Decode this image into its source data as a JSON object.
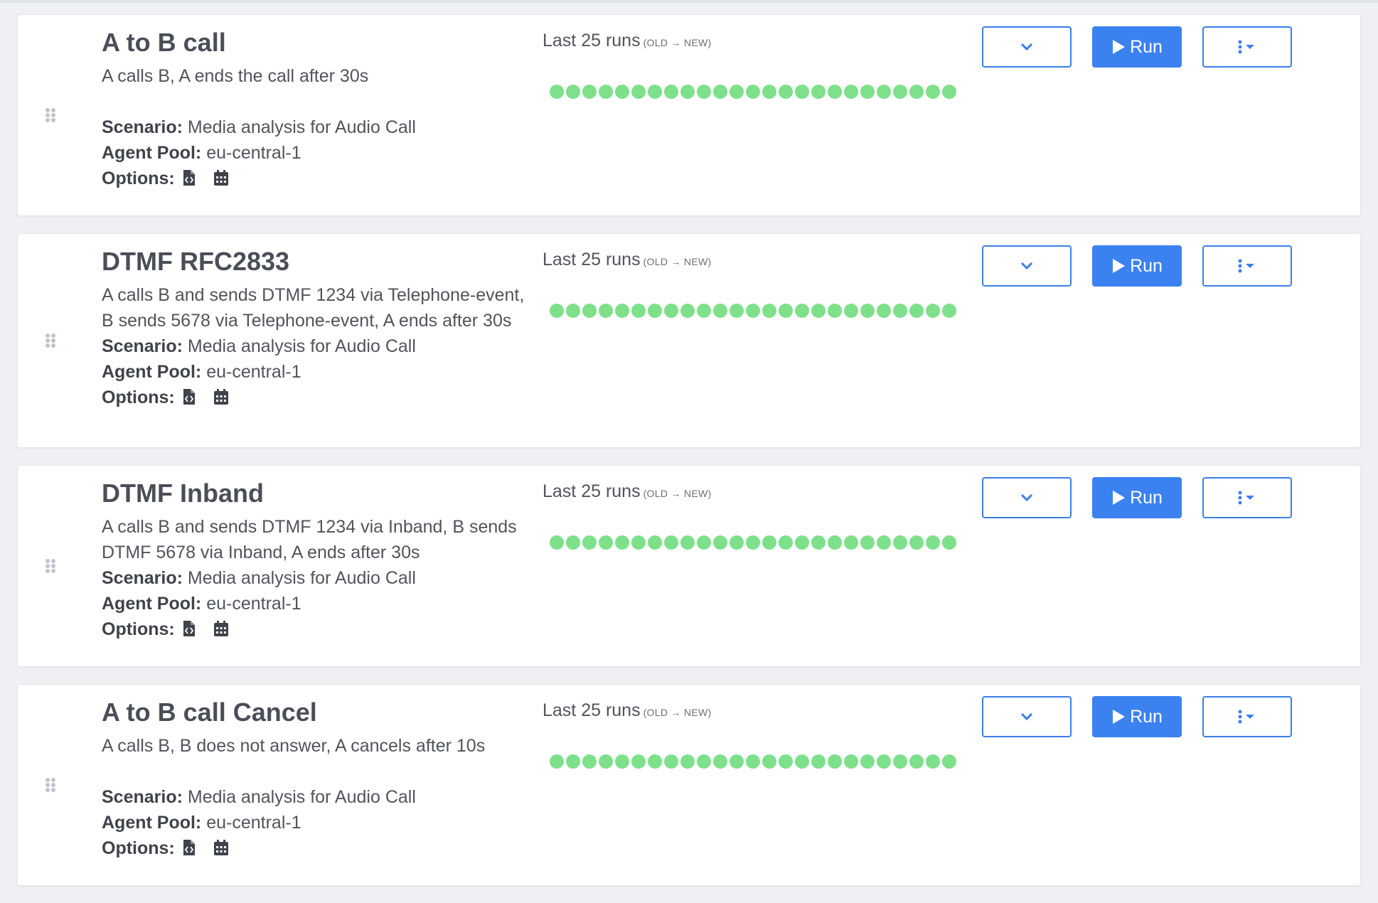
{
  "tests": [
    {
      "title": "A to B call",
      "description": "A calls B, A ends the call after 30s",
      "scenario_label": "Scenario:",
      "scenario": "Media analysis for Audio Call",
      "agent_pool_label": "Agent Pool:",
      "agent_pool": "eu-central-1",
      "options_label": "Options:",
      "runs_label": "Last 25 runs",
      "runs_sub": "(OLD → NEW)",
      "run_label": "Run",
      "runs_status": [
        "pass",
        "pass",
        "pass",
        "pass",
        "pass",
        "pass",
        "pass",
        "pass",
        "pass",
        "pass",
        "pass",
        "pass",
        "pass",
        "pass",
        "pass",
        "pass",
        "pass",
        "pass",
        "pass",
        "pass",
        "pass",
        "pass",
        "pass",
        "pass",
        "pass"
      ]
    },
    {
      "title": "DTMF RFC2833",
      "description": "A calls B and sends DTMF 1234 via Telephone-event, B sends 5678 via Telephone-event, A ends after 30s",
      "scenario_label": "Scenario:",
      "scenario": "Media analysis for Audio Call",
      "agent_pool_label": "Agent Pool:",
      "agent_pool": "eu-central-1",
      "options_label": "Options:",
      "runs_label": "Last 25 runs",
      "runs_sub": "(OLD → NEW)",
      "run_label": "Run",
      "runs_status": [
        "pass",
        "pass",
        "pass",
        "pass",
        "pass",
        "pass",
        "pass",
        "pass",
        "pass",
        "pass",
        "pass",
        "pass",
        "pass",
        "pass",
        "pass",
        "pass",
        "pass",
        "pass",
        "pass",
        "pass",
        "pass",
        "pass",
        "pass",
        "pass",
        "pass"
      ]
    },
    {
      "title": "DTMF Inband",
      "description": "A calls B and sends DTMF 1234 via Inband, B sends DTMF 5678 via Inband, A ends after 30s",
      "scenario_label": "Scenario:",
      "scenario": "Media analysis for Audio Call",
      "agent_pool_label": "Agent Pool:",
      "agent_pool": "eu-central-1",
      "options_label": "Options:",
      "runs_label": "Last 25 runs",
      "runs_sub": "(OLD → NEW)",
      "run_label": "Run",
      "runs_status": [
        "pass",
        "pass",
        "pass",
        "pass",
        "pass",
        "pass",
        "pass",
        "pass",
        "pass",
        "pass",
        "pass",
        "pass",
        "pass",
        "pass",
        "pass",
        "pass",
        "pass",
        "pass",
        "pass",
        "pass",
        "pass",
        "pass",
        "pass",
        "pass",
        "pass"
      ]
    },
    {
      "title": "A to B call Cancel",
      "description": "A calls B, B does not answer, A cancels after 10s",
      "scenario_label": "Scenario:",
      "scenario": "Media analysis for Audio Call",
      "agent_pool_label": "Agent Pool:",
      "agent_pool": "eu-central-1",
      "options_label": "Options:",
      "runs_label": "Last 25 runs",
      "runs_sub": "(OLD → NEW)",
      "run_label": "Run",
      "runs_status": [
        "pass",
        "pass",
        "pass",
        "pass",
        "pass",
        "pass",
        "pass",
        "pass",
        "pass",
        "pass",
        "pass",
        "pass",
        "pass",
        "pass",
        "pass",
        "pass",
        "pass",
        "pass",
        "pass",
        "pass",
        "pass",
        "pass",
        "pass",
        "pass",
        "pass"
      ]
    }
  ],
  "colors": {
    "pass": "#7ee08a",
    "primary": "#3b82f0",
    "text": "#50545c"
  }
}
